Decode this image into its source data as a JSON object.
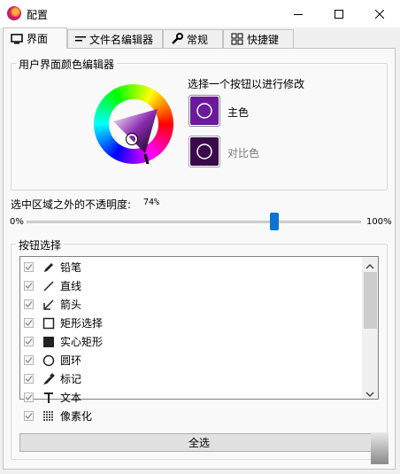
{
  "window": {
    "title": "配置",
    "minimize_icon": "minimize-icon",
    "maximize_icon": "maximize-icon",
    "close_icon": "close-icon"
  },
  "tabs": [
    {
      "label": "界面",
      "icon": "monitor-icon",
      "active": true
    },
    {
      "label": "文件名编辑器",
      "icon": "text-edit-icon",
      "active": false
    },
    {
      "label": "常规",
      "icon": "wrench-icon",
      "active": false
    },
    {
      "label": "快捷键",
      "icon": "grid-icon",
      "active": false
    }
  ],
  "color_editor": {
    "group_title": "用户界面颜色编辑器",
    "instruction": "选择一个按钮以进行修改",
    "primary_label": "主色",
    "contrast_label": "对比色",
    "primary_color": "#6a1a9a",
    "contrast_color": "#3b0a4a"
  },
  "opacity": {
    "label": "选中区域之外的不透明度:",
    "value_text": "74%",
    "min_label": "0%",
    "max_label": "100%",
    "value_fraction": 0.74
  },
  "button_selection": {
    "group_title": "按钮选择",
    "items": [
      {
        "label": "铅笔",
        "icon": "pencil-icon",
        "checked": true
      },
      {
        "label": "直线",
        "icon": "line-icon",
        "checked": true
      },
      {
        "label": "箭头",
        "icon": "arrow-icon",
        "checked": true
      },
      {
        "label": "矩形选择",
        "icon": "rectangle-select-icon",
        "checked": true
      },
      {
        "label": "实心矩形",
        "icon": "filled-rectangle-icon",
        "checked": true
      },
      {
        "label": "圆环",
        "icon": "circle-icon",
        "checked": true
      },
      {
        "label": "标记",
        "icon": "marker-icon",
        "checked": true
      },
      {
        "label": "文本",
        "icon": "text-icon",
        "checked": true
      },
      {
        "label": "像素化",
        "icon": "pixelate-icon",
        "checked": true
      }
    ],
    "select_all_label": "全选"
  }
}
